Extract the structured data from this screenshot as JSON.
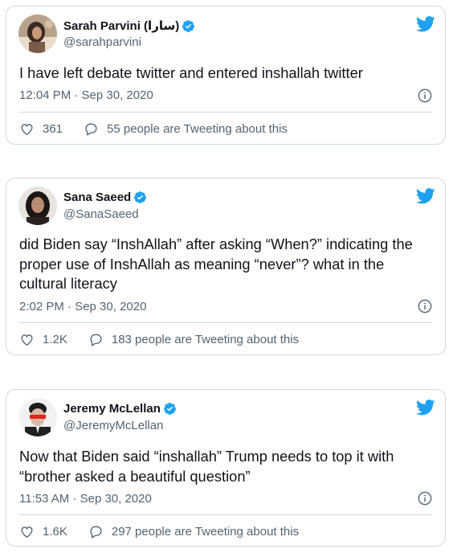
{
  "tweets": [
    {
      "name": "Sarah Parvini (سارا)",
      "handle": "@sarahparvini",
      "text": "I have left debate twitter and entered inshallah twitter",
      "time": "12:04 PM · Sep 30, 2020",
      "likes": "361",
      "replies": "55 people are Tweeting about this"
    },
    {
      "name": "Sana Saeed",
      "handle": "@SanaSaeed",
      "text": "did Biden say “InshAllah” after asking “When?” indicating the proper use of InshAllah as meaning “never”? what in the cultural literacy",
      "time": "2:02 PM · Sep 30, 2020",
      "likes": "1.2K",
      "replies": "183 people are Tweeting about this"
    },
    {
      "name": "Jeremy McLellan",
      "handle": "@JeremyMcLellan",
      "text": "Now that Biden said “inshallah” Trump needs to top it with “brother asked a beautiful question”",
      "time": "11:53 AM · Sep 30, 2020",
      "likes": "1.6K",
      "replies": "297 people are Tweeting about this"
    }
  ],
  "colors": {
    "brand": "#1da1f2",
    "text": "#0f1419",
    "muted": "#536471",
    "border": "#cfd9de"
  },
  "icons": [
    "verified-icon",
    "twitter-bird-icon",
    "info-icon",
    "heart-icon",
    "reply-icon"
  ]
}
